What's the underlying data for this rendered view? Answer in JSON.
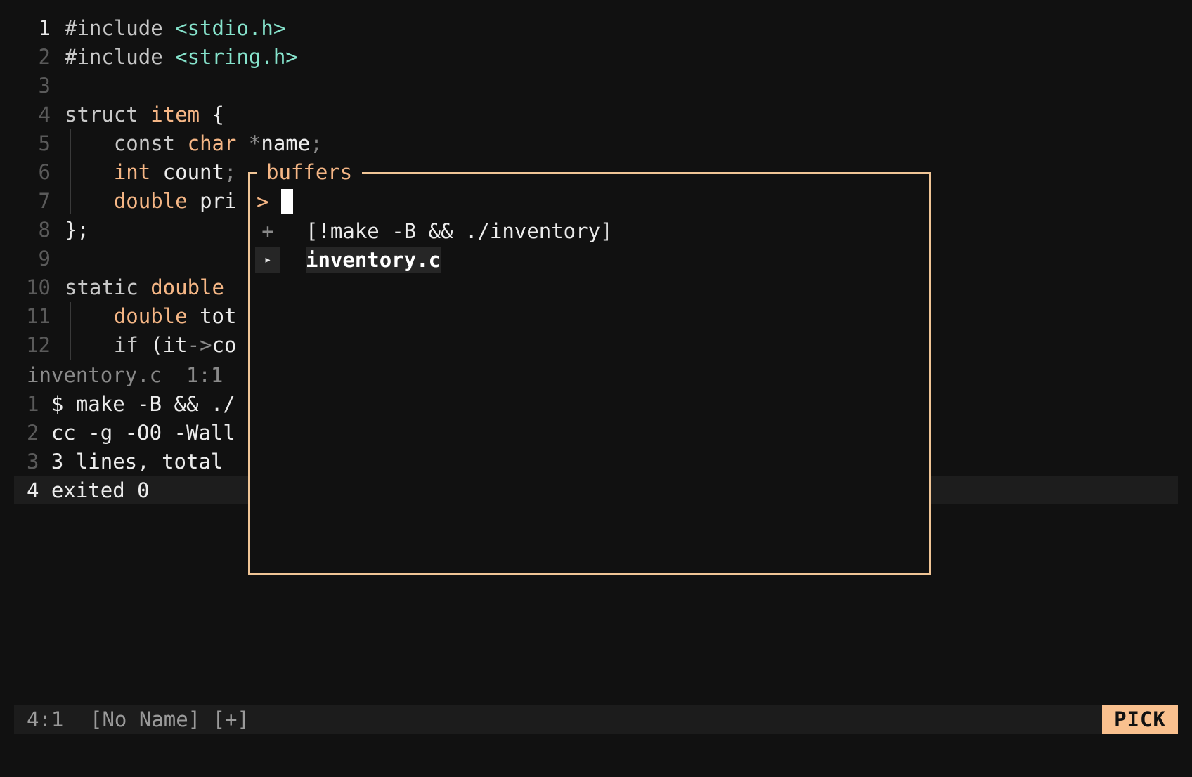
{
  "editor": {
    "lines": [
      {
        "num": "1",
        "parts": [
          {
            "t": "#include ",
            "c": "kw"
          },
          {
            "t": "<stdio.h>",
            "c": "str"
          }
        ]
      },
      {
        "num": "2",
        "parts": [
          {
            "t": "#include ",
            "c": "kw"
          },
          {
            "t": "<string.h>",
            "c": "str"
          }
        ]
      },
      {
        "num": "3",
        "parts": []
      },
      {
        "num": "4",
        "parts": [
          {
            "t": "struct ",
            "c": "kw"
          },
          {
            "t": "item",
            "c": "id"
          },
          {
            "t": " {",
            "c": "txt"
          }
        ]
      },
      {
        "num": "5",
        "parts": [
          {
            "t": "    const ",
            "c": "kw"
          },
          {
            "t": "char",
            "c": "ty"
          },
          {
            "t": " ",
            "c": "txt"
          },
          {
            "t": "*",
            "c": "dim"
          },
          {
            "t": "name",
            "c": "txt"
          },
          {
            "t": ";",
            "c": "dim"
          }
        ]
      },
      {
        "num": "6",
        "parts": [
          {
            "t": "    int",
            "c": "ty"
          },
          {
            "t": " count",
            "c": "txt"
          },
          {
            "t": ";",
            "c": "dim"
          }
        ]
      },
      {
        "num": "7",
        "parts": [
          {
            "t": "    double",
            "c": "ty"
          },
          {
            "t": " pri",
            "c": "txt"
          }
        ]
      },
      {
        "num": "8",
        "parts": [
          {
            "t": "};",
            "c": "txt"
          }
        ]
      },
      {
        "num": "9",
        "parts": []
      },
      {
        "num": "10",
        "parts": [
          {
            "t": "static ",
            "c": "kw"
          },
          {
            "t": "double",
            "c": "ty"
          }
        ]
      },
      {
        "num": "11",
        "parts": [
          {
            "t": "    double",
            "c": "ty"
          },
          {
            "t": " tot",
            "c": "txt"
          }
        ]
      },
      {
        "num": "12",
        "parts": [
          {
            "t": "    if ",
            "c": "kw"
          },
          {
            "t": "(it",
            "c": "txt"
          },
          {
            "t": "->",
            "c": "dim"
          },
          {
            "t": "co",
            "c": "txt"
          }
        ]
      }
    ],
    "file_status": "inventory.c  1:1"
  },
  "terminal": {
    "lines": [
      {
        "num": "1",
        "text": "$ make -B && ./"
      },
      {
        "num": "2",
        "text": "cc -g -O0 -Wall"
      },
      {
        "num": "3",
        "text": "3 lines, total"
      },
      {
        "num": "4",
        "text": "exited 0"
      }
    ]
  },
  "picker": {
    "title": "buffers",
    "prompt": ">",
    "query": "",
    "items": [
      {
        "marker": "+",
        "label": "[!make -B && ./inventory]",
        "selected": false
      },
      {
        "marker": "▸",
        "label": "inventory.c",
        "selected": true
      }
    ]
  },
  "statusline": {
    "position": "4:1",
    "buffer_name": "[No Name] [+]",
    "mode": "PICK"
  },
  "colors": {
    "background": "#111111",
    "accent": "#f5b685",
    "string": "#86e3cc",
    "border": "#f0c596"
  }
}
